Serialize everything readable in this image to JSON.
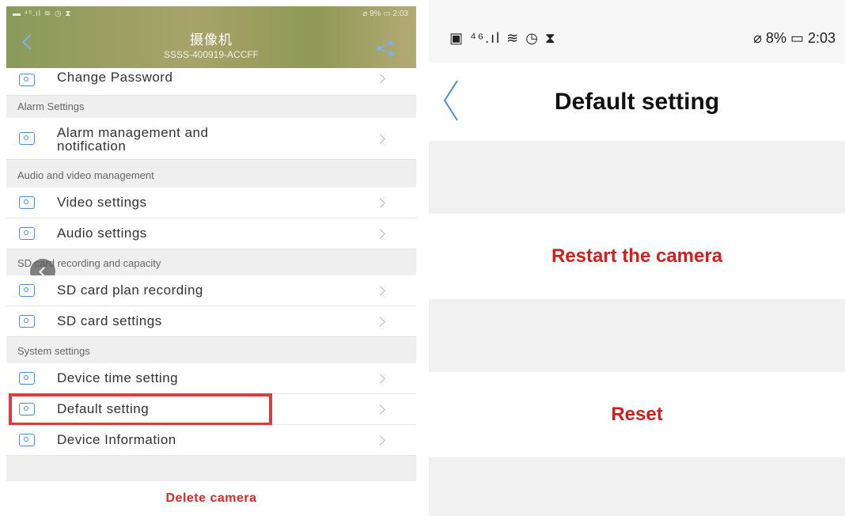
{
  "left": {
    "status_bar": {
      "icons": "▬ ⁴⁶.ıl ≋ ◷ ⧗",
      "right": "⌀ 9% ▭ 2:03"
    },
    "header": {
      "title": "摄像机",
      "subtitle": "SSSS-400919-ACCFF"
    },
    "change_password": "Change Password",
    "sections": {
      "alarm": "Alarm Settings",
      "av": "Audio and video management",
      "sd": "SD card recording and capacity",
      "system": "System settings"
    },
    "items": {
      "alarm_line1": "Alarm management and",
      "alarm_line2": "notification",
      "video": "Video settings",
      "audio": "Audio settings",
      "sd_plan": "SD card plan recording",
      "sd_settings": "SD card settings",
      "time": "Device time setting",
      "default": "Default setting",
      "info": "Device Information"
    },
    "delete": "Delete camera"
  },
  "right": {
    "status_bar": {
      "icons": "▣ ⁴⁶.ıl ≋ ◷ ⧗",
      "right": "⌀ 8% ▭ 2:03"
    },
    "title": "Default setting",
    "restart": "Restart the camera",
    "reset": "Reset"
  },
  "colors": {
    "accent": "#4a8fd6",
    "danger": "#cf2020",
    "highlight": "#e03a3e"
  }
}
